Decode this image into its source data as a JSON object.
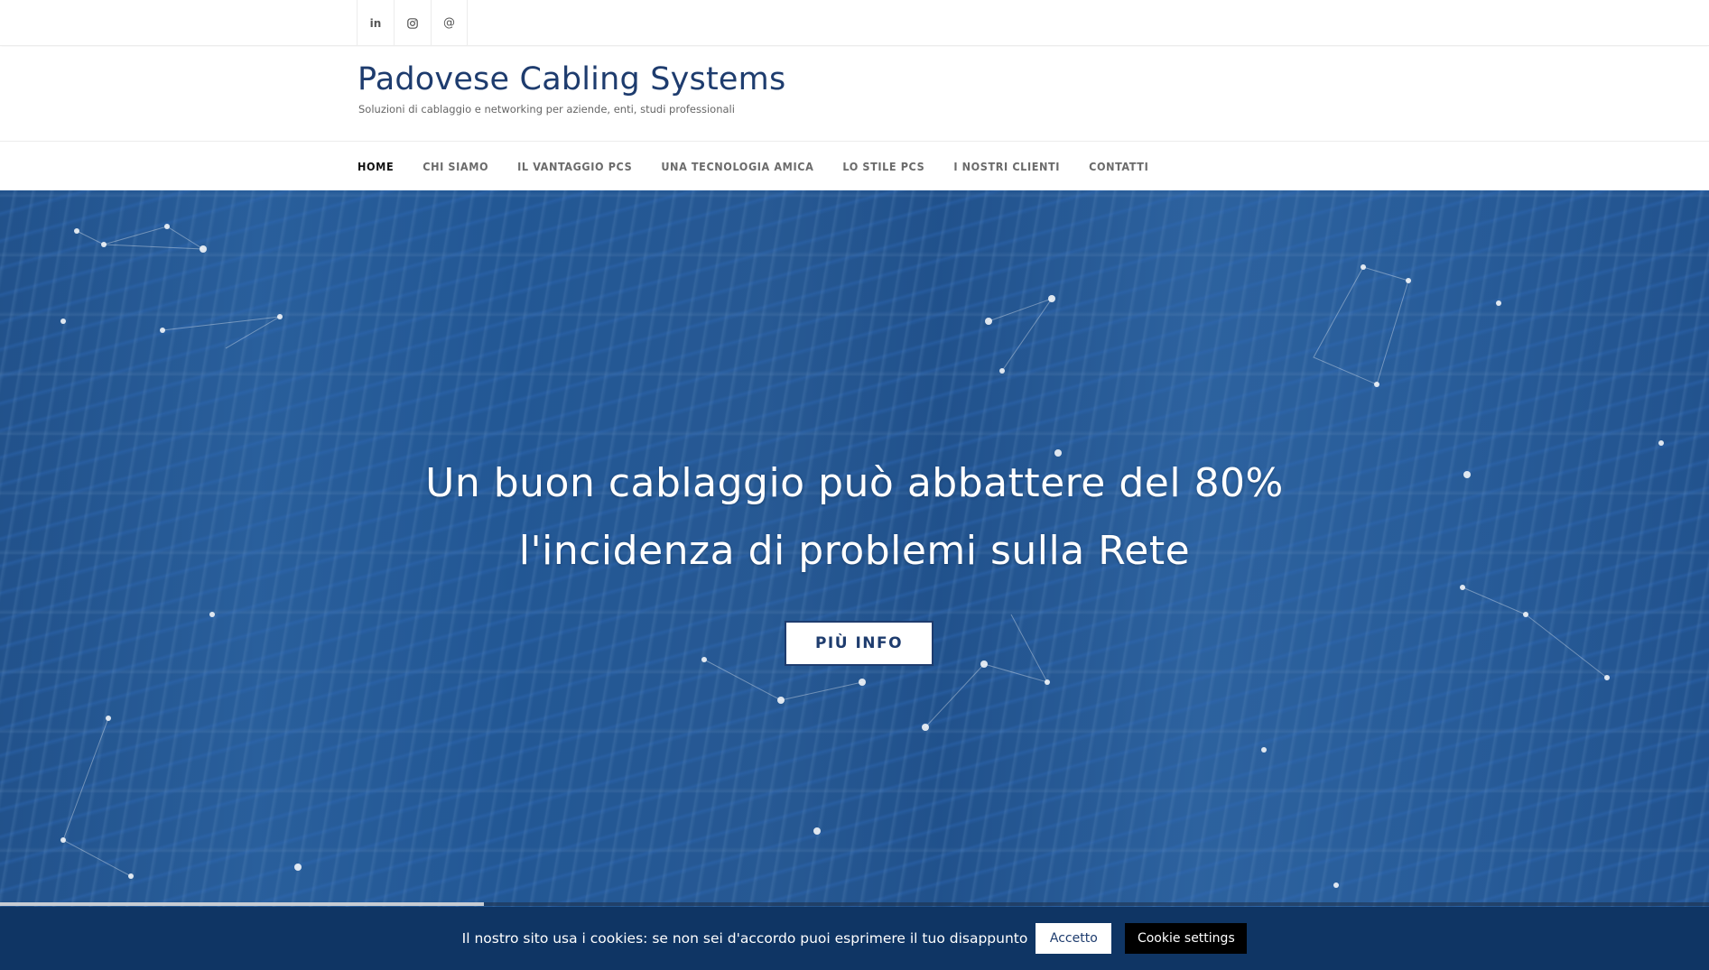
{
  "social": [
    {
      "name": "linkedin-icon",
      "glyph": "in"
    },
    {
      "name": "instagram-icon",
      "glyph": ""
    },
    {
      "name": "email-icon",
      "glyph": "@"
    }
  ],
  "site": {
    "title": "Padovese Cabling Systems",
    "tagline": "Soluzioni di cablaggio e networking per aziende, enti, studi professionali"
  },
  "menu": {
    "items": [
      {
        "label": "HOME",
        "active": true
      },
      {
        "label": "CHI SIAMO"
      },
      {
        "label": "IL VANTAGGIO PCS"
      },
      {
        "label": "UNA TECNOLOGIA AMICA"
      },
      {
        "label": "LO STILE PCS"
      },
      {
        "label": "I NOSTRI CLIENTI"
      },
      {
        "label": "CONTATTI"
      }
    ]
  },
  "hero": {
    "title_line1": "Un buon cablaggio può abbattere del 80%",
    "title_line2": "l'incidenza di problemi sulla Rete",
    "button_label": "PIÙ INFO",
    "slide_progress": 0.283
  },
  "cookie": {
    "text": "Il nostro sito usa i cookies: se non sei d'accordo puoi esprimere il tuo disappunto",
    "accept_label": "Accetto",
    "settings_label": "Cookie settings"
  },
  "colors": {
    "brand": "#1e3c6e",
    "cookie_bar": "#0f3564",
    "hero_overlay": "#2661a0"
  }
}
